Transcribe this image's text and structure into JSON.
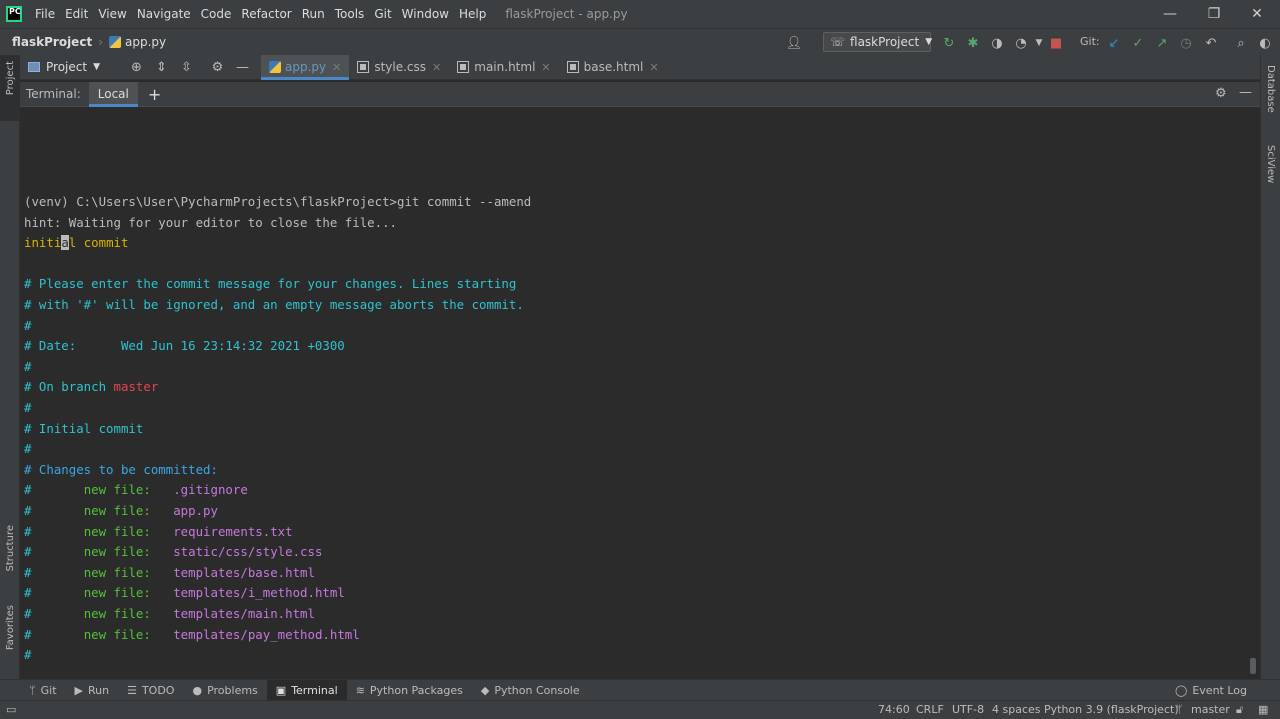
{
  "app": {
    "menu": [
      "File",
      "Edit",
      "View",
      "Navigate",
      "Code",
      "Refactor",
      "Run",
      "Tools",
      "Git",
      "Window",
      "Help"
    ],
    "window_title": "flaskProject - app.py",
    "logo_text": "PC"
  },
  "nav": {
    "project": "flaskProject",
    "file": "app.py",
    "run_config": "flaskProject",
    "git_label": "Git:"
  },
  "tabs": {
    "project_selector": "Project",
    "files": [
      {
        "label": "app.py",
        "active": true
      },
      {
        "label": "style.css",
        "active": false
      },
      {
        "label": "main.html",
        "active": false
      },
      {
        "label": "base.html",
        "active": false
      }
    ]
  },
  "side": {
    "left": [
      "Project",
      "Structure",
      "Favorites"
    ],
    "right": [
      "Database",
      "SciView"
    ]
  },
  "terminal": {
    "header_label": "Terminal:",
    "tab_label": "Local",
    "lines": [
      {
        "segments": [
          {
            "t": "(venv) C:\\Users\\User\\PycharmProjects\\flaskProject>git commit --amend",
            "c": "def"
          }
        ]
      },
      {
        "segments": [
          {
            "t": "hint: Waiting for your editor to close the file...",
            "c": "def"
          }
        ]
      },
      {
        "segments": [
          {
            "t": "initi",
            "c": "yel"
          },
          {
            "t": "a",
            "c": "cursor"
          },
          {
            "t": "l commit",
            "c": "yel"
          }
        ]
      },
      {
        "segments": []
      },
      {
        "segments": [
          {
            "t": "# Please enter the commit message for your changes. Lines starting",
            "c": "cyan"
          }
        ]
      },
      {
        "segments": [
          {
            "t": "# with '#' will be ignored, and an empty message aborts the commit.",
            "c": "cyan"
          }
        ]
      },
      {
        "segments": [
          {
            "t": "#",
            "c": "cyan"
          }
        ]
      },
      {
        "segments": [
          {
            "t": "# Date:      Wed Jun 16 23:14:32 2021 +0300",
            "c": "cyan"
          }
        ]
      },
      {
        "segments": [
          {
            "t": "#",
            "c": "cyan"
          }
        ]
      },
      {
        "segments": [
          {
            "t": "# On branch ",
            "c": "cyan"
          },
          {
            "t": "master",
            "c": "red"
          }
        ]
      },
      {
        "segments": [
          {
            "t": "#",
            "c": "cyan"
          }
        ]
      },
      {
        "segments": [
          {
            "t": "# Initial commit",
            "c": "cyan"
          }
        ]
      },
      {
        "segments": [
          {
            "t": "#",
            "c": "cyan"
          }
        ]
      },
      {
        "segments": [
          {
            "t": "# Changes to be committed:",
            "c": "blue"
          }
        ]
      },
      {
        "segments": [
          {
            "t": "#       ",
            "c": "cyan"
          },
          {
            "t": "new file:   ",
            "c": "green"
          },
          {
            "t": ".gitignore",
            "c": "mag"
          }
        ]
      },
      {
        "segments": [
          {
            "t": "#       ",
            "c": "cyan"
          },
          {
            "t": "new file:   ",
            "c": "green"
          },
          {
            "t": "app.py",
            "c": "mag"
          }
        ]
      },
      {
        "segments": [
          {
            "t": "#       ",
            "c": "cyan"
          },
          {
            "t": "new file:   ",
            "c": "green"
          },
          {
            "t": "requirements.txt",
            "c": "mag"
          }
        ]
      },
      {
        "segments": [
          {
            "t": "#       ",
            "c": "cyan"
          },
          {
            "t": "new file:   ",
            "c": "green"
          },
          {
            "t": "static/css/style.css",
            "c": "mag"
          }
        ]
      },
      {
        "segments": [
          {
            "t": "#       ",
            "c": "cyan"
          },
          {
            "t": "new file:   ",
            "c": "green"
          },
          {
            "t": "templates/base.html",
            "c": "mag"
          }
        ]
      },
      {
        "segments": [
          {
            "t": "#       ",
            "c": "cyan"
          },
          {
            "t": "new file:   ",
            "c": "green"
          },
          {
            "t": "templates/i_method.html",
            "c": "mag"
          }
        ]
      },
      {
        "segments": [
          {
            "t": "#       ",
            "c": "cyan"
          },
          {
            "t": "new file:   ",
            "c": "green"
          },
          {
            "t": "templates/main.html",
            "c": "mag"
          }
        ]
      },
      {
        "segments": [
          {
            "t": "#       ",
            "c": "cyan"
          },
          {
            "t": "new file:   ",
            "c": "green"
          },
          {
            "t": "templates/pay_method.html",
            "c": "mag"
          }
        ]
      },
      {
        "segments": [
          {
            "t": "#",
            "c": "cyan"
          }
        ]
      }
    ]
  },
  "bottom_tools": [
    {
      "label": "Git",
      "icon": "git-icon",
      "glyph": "ᛘ"
    },
    {
      "label": "Run",
      "icon": "run-icon",
      "glyph": "▶"
    },
    {
      "label": "TODO",
      "icon": "todo-icon",
      "glyph": "☰"
    },
    {
      "label": "Problems",
      "icon": "problems-icon",
      "glyph": "●"
    },
    {
      "label": "Terminal",
      "icon": "terminal-icon",
      "glyph": "▣",
      "active": true
    },
    {
      "label": "Python Packages",
      "icon": "packages-icon",
      "glyph": "≋"
    },
    {
      "label": "Python Console",
      "icon": "python-console-icon",
      "glyph": "◆"
    }
  ],
  "event_log": "Event Log",
  "status": {
    "position": "74:60",
    "line_sep": "CRLF",
    "encoding": "UTF-8",
    "indent": "4 spaces",
    "interpreter": "Python 3.9 (flaskProject)",
    "branch": "master"
  }
}
